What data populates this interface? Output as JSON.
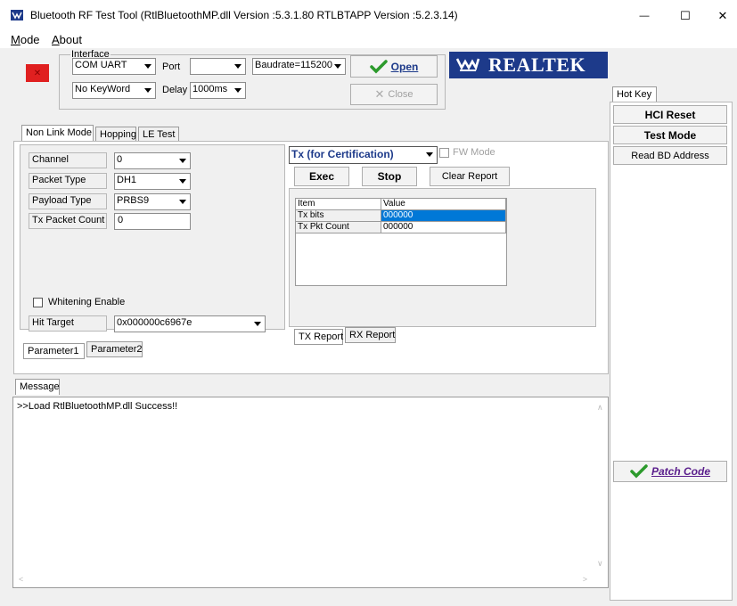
{
  "window": {
    "title": "Bluetooth RF Test Tool (RtlBluetoothMP.dll Version :5.3.1.80   RTLBTAPP Version :5.2.3.14)",
    "minimize_glyph": "—",
    "maximize_glyph": "☐",
    "close_glyph": "✕"
  },
  "menu": {
    "mode": "Mode",
    "about": "About"
  },
  "interface": {
    "group_label": "Interface",
    "com_value": "COM UART",
    "port_label": "Port",
    "port_value": "",
    "baudrate_value": "Baudrate=115200",
    "keyword_value": "No KeyWord",
    "delay_label": "Delay",
    "delay_value": "1000ms",
    "open_label": "Open",
    "close_label": "Close"
  },
  "brand": {
    "name": "REALTEK"
  },
  "hotkey": {
    "tab": "Hot Key",
    "hci_reset": "HCI Reset",
    "test_mode": "Test Mode",
    "read_bd": "Read BD Address",
    "patch_code": "Patch Code"
  },
  "mode_tabs": [
    "Non Link Mode",
    "Hopping",
    "LE Test"
  ],
  "params": {
    "channel_label": "Channel",
    "channel_value": "0",
    "packet_type_label": "Packet Type",
    "packet_type_value": "DH1",
    "payload_type_label": "Payload Type",
    "payload_type_value": "PRBS9",
    "tx_count_label": "Tx Packet Count",
    "tx_count_value": "0",
    "whitening_label": "Whitening Enable",
    "hit_target_label": "Hit Target",
    "hit_target_value": "0x000000c6967e"
  },
  "param_tabs": [
    "Parameter1",
    "Parameter2"
  ],
  "tx": {
    "mode_value": "Tx (for Certification)",
    "fw_mode_label": "FW Mode",
    "exec": "Exec",
    "stop": "Stop",
    "clear_report": "Clear Report",
    "grid_headers": [
      "Item",
      "Value"
    ],
    "grid_rows": [
      {
        "item": "Tx bits",
        "value": "000000"
      },
      {
        "item": "Tx Pkt Count",
        "value": "000000"
      }
    ]
  },
  "report_tabs": [
    "TX Report",
    "RX Report"
  ],
  "message": {
    "tab": "Message",
    "text": ">>Load RtlBluetoothMP.dll Success!!"
  },
  "colors": {
    "brand_bg": "#1d3a8a",
    "status_red": "#e02020",
    "selection": "#0078d7",
    "check_green": "#2c9a2c",
    "patch_purple": "#5a1e8c"
  }
}
